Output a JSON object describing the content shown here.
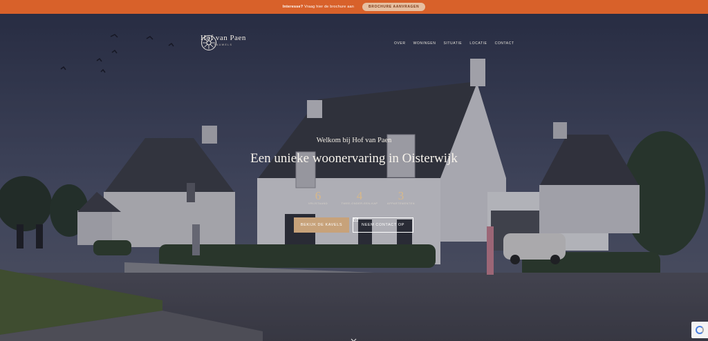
{
  "topbar": {
    "lead": "Interesse?",
    "text": "Vraag hier de brochure aan",
    "button": "BROCHURE AANVRAGEN"
  },
  "header": {
    "logo_name": "Hof van Paen",
    "logo_sub": "PAUWELS",
    "nav": [
      "OVER",
      "WONINGEN",
      "SITUATIE",
      "LOCATIE",
      "CONTACT"
    ]
  },
  "hero": {
    "welcome": "Welkom bij Hof van Paen",
    "headline": "Een unieke woonervaring in Oisterwijk",
    "stats": [
      {
        "num": "6",
        "label": "VRIJSTAAND"
      },
      {
        "num": "4",
        "label": "TWEE-ONDER-EEN-KAP"
      },
      {
        "num": "3",
        "label": "APPARTEMENTEN"
      }
    ],
    "cta_primary": "BEKIJK DE KAVELS",
    "cta_secondary": "NEEM CONTACT OP"
  },
  "colors": {
    "topbar": "#d8612a",
    "accent": "#c7a27a",
    "stat_number": "#d7b88a"
  },
  "icons": {
    "logo": "sunburst-logo-icon",
    "contact": "mail-icon",
    "scroll": "chevron-down-icon",
    "recaptcha": "recaptcha-icon"
  }
}
